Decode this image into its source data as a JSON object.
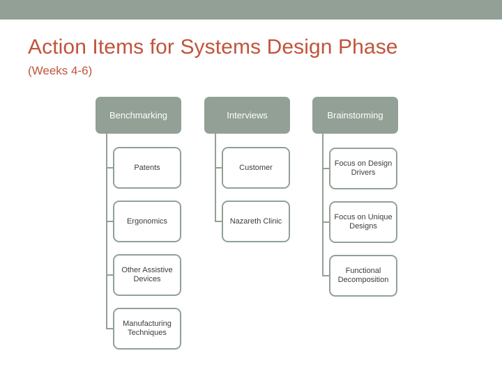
{
  "slide": {
    "title": "Action Items for Systems Design Phase",
    "subtitle": "(Weeks 4-6)",
    "accent_color": "#c0543c",
    "theme_color": "#92a096",
    "background_color": "#ffffff",
    "node_text_color": "#3b3b3b",
    "header_text_color": "#ffffff"
  },
  "diagram": {
    "type": "hierarchy",
    "columns": [
      {
        "header": "Benchmarking",
        "children": [
          "Patents",
          "Ergonomics",
          "Other Assistive Devices",
          "Manufacturing Techniques"
        ]
      },
      {
        "header": "Interviews",
        "children": [
          "Customer",
          "Nazareth Clinic"
        ]
      },
      {
        "header": "Brainstorming",
        "children": [
          "Focus on Design Drivers",
          "Focus on Unique Designs",
          "Functional Decomposition"
        ]
      }
    ]
  }
}
